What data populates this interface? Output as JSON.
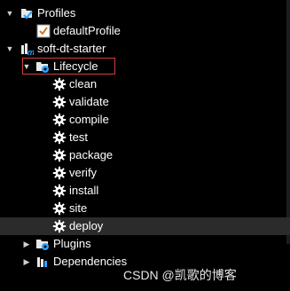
{
  "tree": {
    "profiles": {
      "label": "Profiles",
      "children": [
        "defaultProfile"
      ]
    },
    "project": {
      "label": "soft-dt-starter"
    },
    "lifecycle": {
      "label": "Lifecycle",
      "phases": [
        "clean",
        "validate",
        "compile",
        "test",
        "package",
        "verify",
        "install",
        "site",
        "deploy"
      ]
    },
    "plugins": {
      "label": "Plugins"
    },
    "dependencies": {
      "label": "Dependencies"
    }
  },
  "watermark": "CSDN @凯歌的博客"
}
